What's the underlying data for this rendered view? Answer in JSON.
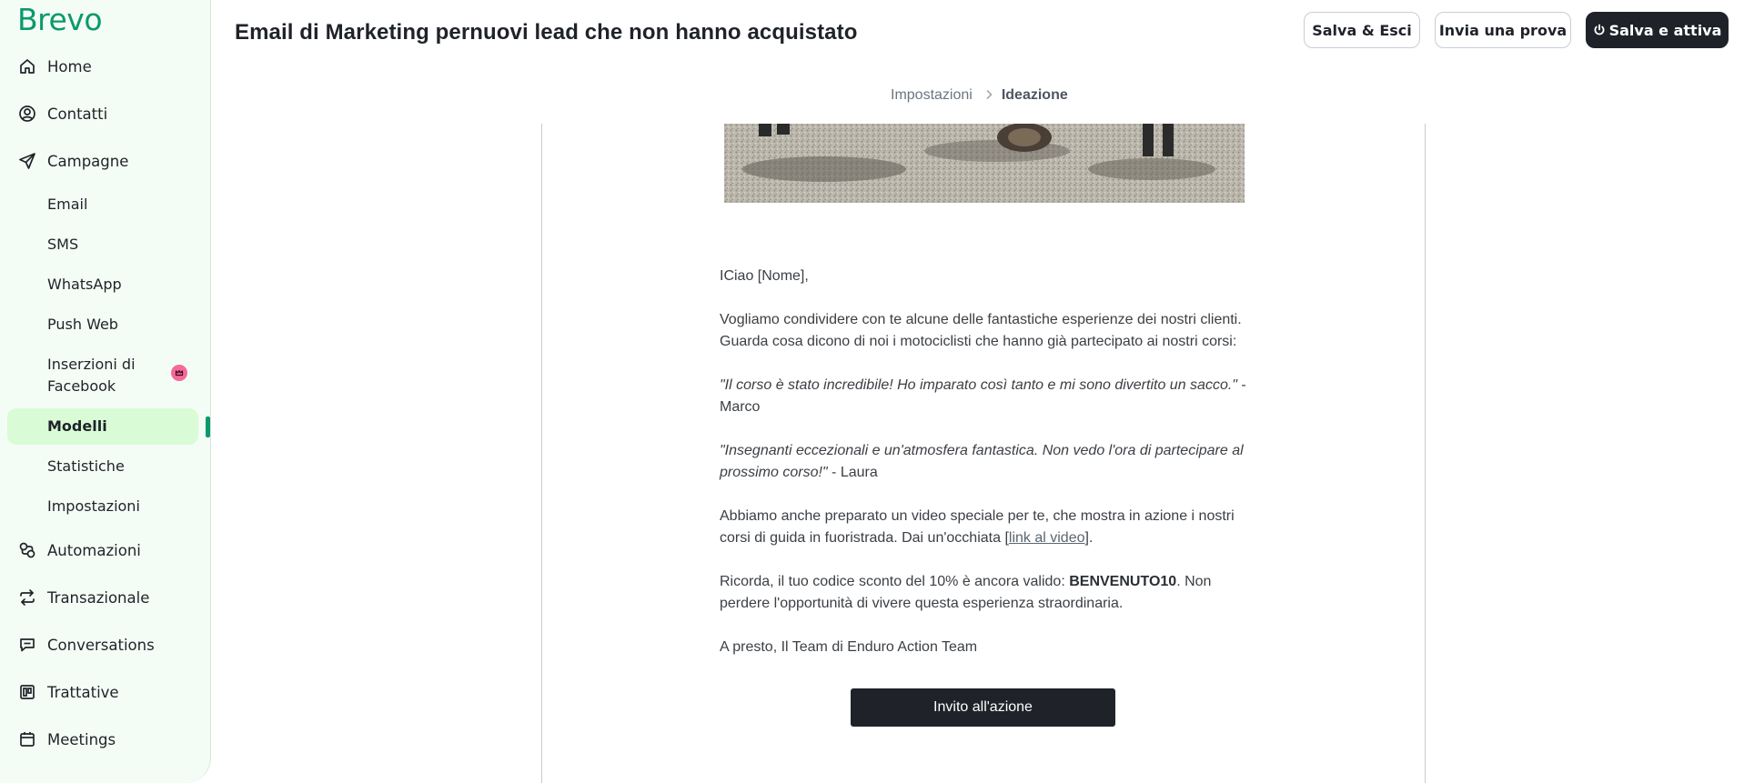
{
  "app": {
    "logo": "Brevo",
    "brand_color": "#0b996e"
  },
  "sidebar": {
    "main_items": [
      {
        "label": "Home",
        "icon": "home-icon"
      },
      {
        "label": "Contatti",
        "icon": "contacts-icon"
      },
      {
        "label": "Campagne",
        "icon": "paper-plane-icon"
      },
      {
        "label": "Automazioni",
        "icon": "automation-icon"
      },
      {
        "label": "Transazionale",
        "icon": "transactional-icon"
      },
      {
        "label": "Conversations",
        "icon": "chat-icon"
      },
      {
        "label": "Trattative",
        "icon": "deals-icon"
      },
      {
        "label": "Meetings",
        "icon": "calendar-icon"
      }
    ],
    "campaign_sub_items": [
      {
        "label": "Email"
      },
      {
        "label": "SMS"
      },
      {
        "label": "WhatsApp"
      },
      {
        "label": "Push Web"
      },
      {
        "label": "Inserzioni di Facebook",
        "badge": "crown-icon"
      },
      {
        "label": "Modelli",
        "active": true
      },
      {
        "label": "Statistiche"
      },
      {
        "label": "Impostazioni"
      }
    ]
  },
  "header": {
    "title": "Email di Marketing pernuovi lead che non hanno acquistato",
    "save_exit_label": "Salva & Esci",
    "send_test_label": "Invia una prova",
    "save_activate_label": "Salva e attiva"
  },
  "breadcrumb": {
    "step_1": "Impostazioni",
    "step_2": "Ideazione"
  },
  "email": {
    "greeting": "ICiao [Nome],",
    "intro": "Vogliamo condividere con te alcune delle fantastiche esperienze dei nostri clienti. Guarda cosa dicono di noi i motociclisti che hanno già partecipato ai nostri corsi:",
    "testimonial_1_quote": "\"Il corso è stato incredibile! Ho imparato così tanto e mi sono divertito un sacco.\"",
    "testimonial_1_author": " - Marco",
    "testimonial_2_quote": "\"Insegnanti eccezionali e un'atmosfera fantastica. Non vedo l'ora di partecipare al prossimo corso!\"",
    "testimonial_2_author": " - Laura",
    "video_text": "Abbiamo anche preparato un video speciale per te, che mostra in azione i nostri corsi di guida in fuoristrada. Dai un'occhiata [",
    "video_link": "link al video",
    "video_text_end": "].",
    "discount_text": "Ricorda, il tuo codice sconto del 10% è ancora valido: ",
    "discount_code": "BENVENUTO10",
    "discount_text_end": ". Non perdere l'opportunità di vivere questa esperienza straordinaria.",
    "signoff": "A presto, Il Team di Enduro Action Team",
    "cta_label": "Invito all'azione"
  }
}
